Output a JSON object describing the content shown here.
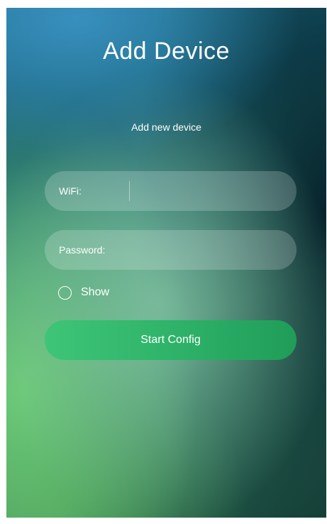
{
  "header": {
    "title": "Add Device",
    "subtitle": "Add new device"
  },
  "form": {
    "wifi": {
      "label": "WiFi:",
      "value": ""
    },
    "password": {
      "label": "Password:",
      "value": ""
    },
    "show_password": {
      "label": "Show",
      "checked": false
    },
    "submit_label": "Start Config"
  },
  "colors": {
    "button_start": "#3ec577",
    "button_end": "#1f9d58",
    "background_top": "#1f6f8c",
    "background_dark": "#1a4a3c",
    "text": "#ffffff"
  }
}
